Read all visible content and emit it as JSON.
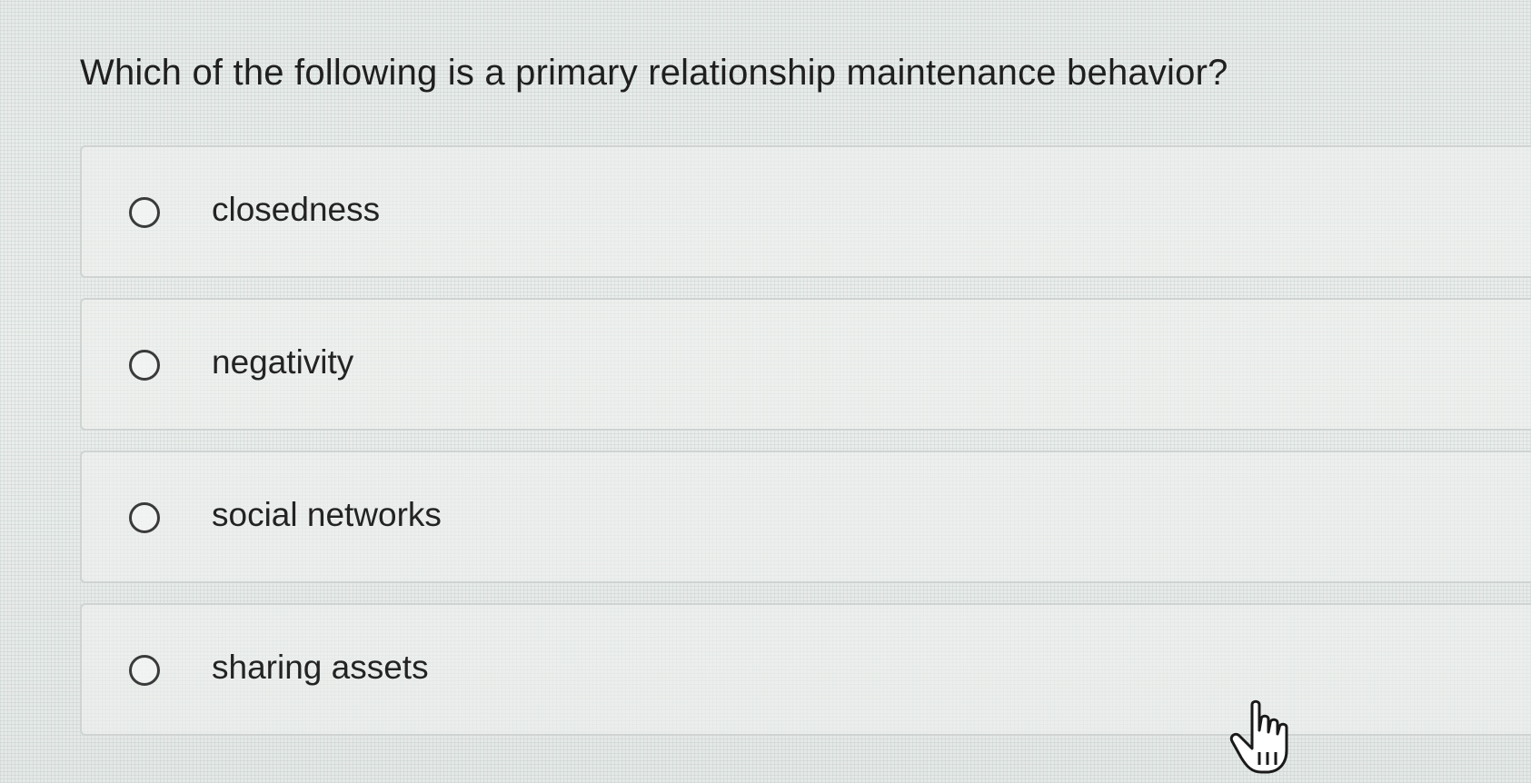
{
  "question": {
    "text": "Which of the following is a primary relationship maintenance behavior?"
  },
  "options": [
    {
      "label": "closedness",
      "selected": false
    },
    {
      "label": "negativity",
      "selected": false
    },
    {
      "label": "social networks",
      "selected": false
    },
    {
      "label": "sharing assets",
      "selected": false
    }
  ],
  "icons": {
    "radio": "radio-unchecked-icon",
    "cursor": "hand-pointer-cursor-icon"
  },
  "colors": {
    "background": "#e9ecea",
    "option_border": "#cfd4d2",
    "text": "#222222"
  }
}
